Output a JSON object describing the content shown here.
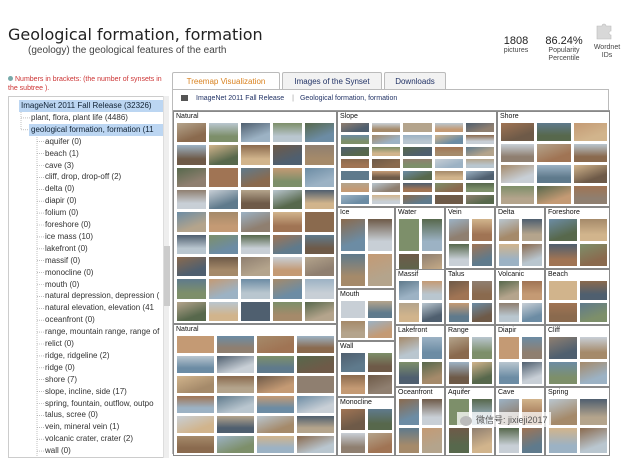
{
  "header": {
    "title": "Geological formation, formation",
    "subtitle": "(geology) the geological features of the earth",
    "stats": [
      {
        "value": "1808",
        "label": "pictures"
      },
      {
        "value": "86.24%",
        "label": "Popularity Percentile"
      },
      {
        "value": "",
        "label": "Wordnet IDs"
      }
    ]
  },
  "sidebar": {
    "note": "Numbers in brackets: (the number of synsets in the subtree ).",
    "items": [
      {
        "label": "ImageNet 2011 Fall Release (32326)",
        "depth": 0,
        "selected": true
      },
      {
        "label": "plant, flora, plant life (4486)",
        "depth": 1
      },
      {
        "label": "geological formation, formation (11",
        "depth": 1,
        "selected": true
      },
      {
        "label": "aquifer (0)",
        "depth": 2
      },
      {
        "label": "beach (1)",
        "depth": 2
      },
      {
        "label": "cave (3)",
        "depth": 2
      },
      {
        "label": "cliff, drop, drop-off (2)",
        "depth": 2
      },
      {
        "label": "delta (0)",
        "depth": 2
      },
      {
        "label": "diapir (0)",
        "depth": 2
      },
      {
        "label": "folium (0)",
        "depth": 2
      },
      {
        "label": "foreshore (0)",
        "depth": 2
      },
      {
        "label": "ice mass (10)",
        "depth": 2
      },
      {
        "label": "lakefront (0)",
        "depth": 2
      },
      {
        "label": "massif (0)",
        "depth": 2
      },
      {
        "label": "monocline (0)",
        "depth": 2
      },
      {
        "label": "mouth (0)",
        "depth": 2
      },
      {
        "label": "natural depression, depression (",
        "depth": 2
      },
      {
        "label": "natural elevation, elevation (41",
        "depth": 2
      },
      {
        "label": "oceanfront (0)",
        "depth": 2
      },
      {
        "label": "range, mountain range, range of",
        "depth": 2
      },
      {
        "label": "relict (0)",
        "depth": 2
      },
      {
        "label": "ridge, ridgeline (2)",
        "depth": 2
      },
      {
        "label": "ridge (0)",
        "depth": 2
      },
      {
        "label": "shore (7)",
        "depth": 2
      },
      {
        "label": "slope, incline, side (17)",
        "depth": 2
      },
      {
        "label": "spring, fountain, outflow, outpo",
        "depth": 2
      },
      {
        "label": "talus, scree (0)",
        "depth": 2
      },
      {
        "label": "vein, mineral vein (1)",
        "depth": 2
      },
      {
        "label": "volcanic crater, crater (2)",
        "depth": 2
      },
      {
        "label": "wall (0)",
        "depth": 2
      }
    ]
  },
  "tabs": [
    {
      "label": "Treemap Visualization",
      "active": true
    },
    {
      "label": "Images of the Synset",
      "active": false
    },
    {
      "label": "Downloads",
      "active": false
    }
  ],
  "breadcrumb": [
    "ImageNet 2011 Fall Release",
    "Geological formation, formation"
  ],
  "treemap": [
    {
      "label": "Natural"
    },
    {
      "label": "Natural"
    },
    {
      "label": "Slope"
    },
    {
      "label": "Shore"
    },
    {
      "label": "Ice"
    },
    {
      "label": "Water"
    },
    {
      "label": "Vein"
    },
    {
      "label": "Delta"
    },
    {
      "label": "Foreshore"
    },
    {
      "label": "Mouth"
    },
    {
      "label": "Massif"
    },
    {
      "label": "Talus"
    },
    {
      "label": "Volcanic"
    },
    {
      "label": "Beach"
    },
    {
      "label": "Wall"
    },
    {
      "label": "Lakefront"
    },
    {
      "label": "Range"
    },
    {
      "label": "Diapir"
    },
    {
      "label": "Cliff"
    },
    {
      "label": "Monocline"
    },
    {
      "label": "Oceanfront"
    },
    {
      "label": "Aquifer"
    },
    {
      "label": "Cave"
    },
    {
      "label": "Spring"
    }
  ],
  "watermark": "微信号: jixieji2017",
  "colors": {
    "accent": "#d9821f",
    "link": "#223366",
    "selection": "#bcd6f2",
    "note": "#cc3333"
  },
  "icons": [
    "home-icon",
    "wordnet-puzzle-icon",
    "wechat-icon"
  ]
}
